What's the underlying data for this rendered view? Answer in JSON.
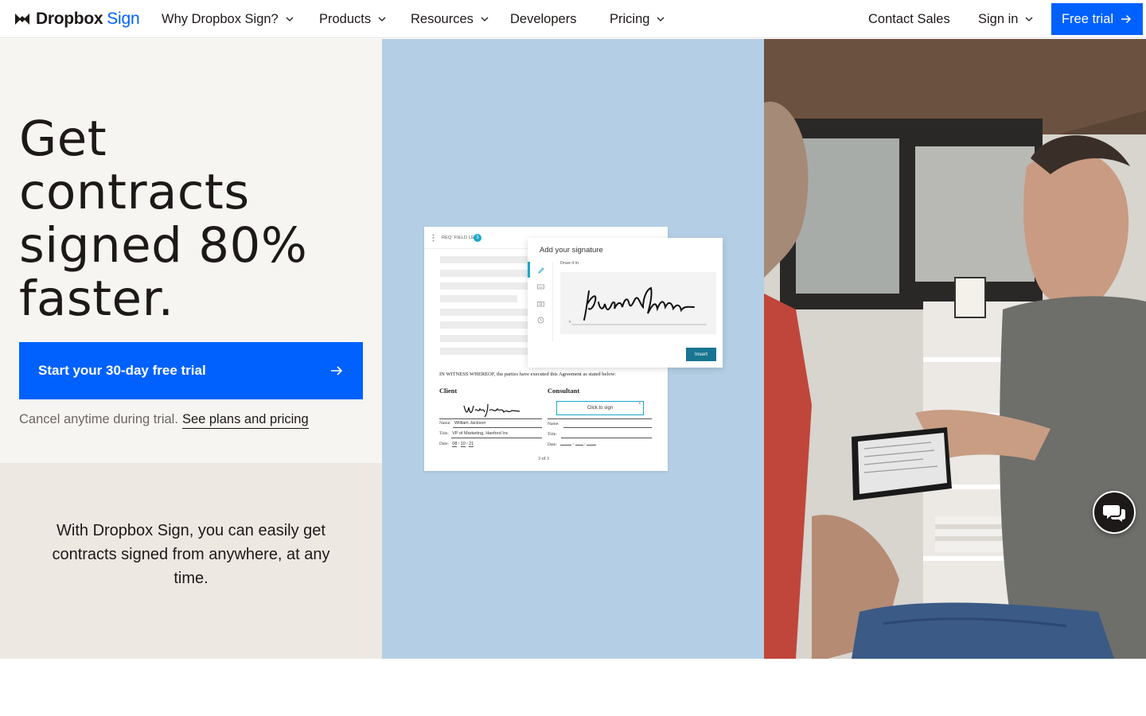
{
  "nav": {
    "logo_word": "Dropbox",
    "logo_sign": "Sign",
    "items": [
      {
        "label": "Why Dropbox Sign?",
        "dropdown": true
      },
      {
        "label": "Products",
        "dropdown": true
      },
      {
        "label": "Resources",
        "dropdown": true
      },
      {
        "label": "Developers",
        "dropdown": false
      },
      {
        "label": "Pricing",
        "dropdown": true
      }
    ],
    "contact": "Contact Sales",
    "signin": "Sign in",
    "cta": "Free trial"
  },
  "hero": {
    "headline_lines": [
      "Get",
      "contracts",
      "signed 80%",
      "faster."
    ],
    "cta": "Start your 30-day free trial",
    "cancel_text": "Cancel anytime during trial.",
    "plans_link": "See plans and pricing"
  },
  "sub": {
    "text": "With Dropbox Sign, you can easily get contracts signed from anywhere, at any time."
  },
  "mockup": {
    "req_label": "REQ' FIELD LEFT",
    "req_count": "3",
    "witness": "IN WITNESS WHEREOF, the parties have executed this Agreement as stated below:",
    "client": "Client",
    "consultant": "Consultant",
    "name_label": "Name:",
    "name_value": "William Jackson",
    "title_label": "Title:",
    "title_value": "VP of Marketing, Hanford Inc",
    "date_label": "Date:",
    "date_mm": "08",
    "date_dd": "10",
    "date_yy": "21",
    "click_to_sign": "Click to sign",
    "page_no": "3 of 3",
    "modal_title": "Add your signature",
    "draw_it_in": "Draw it in",
    "insert": "Insert"
  },
  "colors": {
    "brand_blue": "#0061fe",
    "hero_bg": "#f7f5f2",
    "sub_bg": "#ede8e2",
    "mid_bg": "#b4cfe5"
  }
}
